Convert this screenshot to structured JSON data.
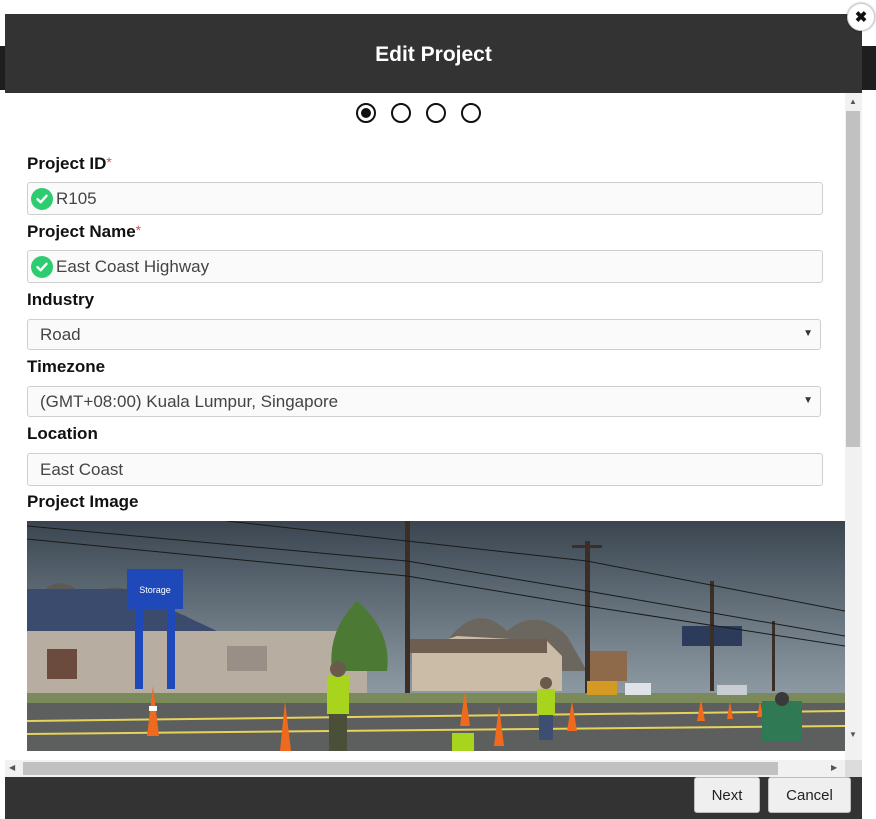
{
  "modal": {
    "title": "Edit Project",
    "close_symbol": "✖",
    "steps": {
      "total": 4,
      "current": 1
    }
  },
  "form": {
    "project_id": {
      "label": "Project ID",
      "required_mark": "*",
      "value": "R105",
      "status_icon": "check-circle-icon"
    },
    "project_name": {
      "label": "Project Name",
      "required_mark": "*",
      "value": "East Coast Highway",
      "status_icon": "check-circle-icon"
    },
    "industry": {
      "label": "Industry",
      "selected": "Road"
    },
    "timezone": {
      "label": "Timezone",
      "selected": "(GMT+08:00) Kuala Lumpur, Singapore"
    },
    "location": {
      "label": "Location",
      "value": "East Coast"
    },
    "project_image": {
      "label": "Project Image",
      "sign_text": "Storage"
    }
  },
  "footer": {
    "next_label": "Next",
    "cancel_label": "Cancel"
  },
  "colors": {
    "header": "#333333",
    "valid": "#2ecc71",
    "required": "#d9534f"
  }
}
